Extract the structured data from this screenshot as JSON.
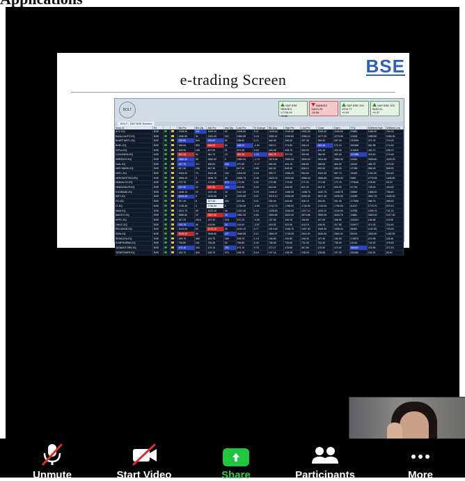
{
  "page_heading": "Applications",
  "slide": {
    "logo": "BSE",
    "title": "e-trading Screen"
  },
  "ets": {
    "logo_label": "BOLT",
    "tab": "BOLT - S&P BSE Sensex",
    "indices": [
      {
        "name": "S&P BSE SENSEX",
        "value": "17735.94",
        "change": "+5.80",
        "trend": "up"
      },
      {
        "name": "BANKEX",
        "value": "11813.25",
        "change": "-18.08",
        "trend": "dn"
      },
      {
        "name": "S&P BSE 200",
        "value": "2203.77",
        "change": "+0.93",
        "trend": "up"
      },
      {
        "name": "S&P BSE 100",
        "value": "5483.51",
        "change": "+0.37",
        "trend": "up"
      }
    ],
    "columns": [
      "Scrip Id",
      "Ex",
      "",
      "",
      "Bid Prc",
      "Bid Qty",
      "Ask Prc",
      "Ask Qty",
      "Last Prc",
      "% Change",
      "Wt. Avg",
      "High Prc",
      "Low Prc",
      "Close",
      "Open",
      "TTQ",
      "52Week High",
      "52Week Low"
    ],
    "rows": [
      {
        "sym": "ACC-EQ",
        "ex": "BSE",
        "bid": "1008.50",
        "bq": "101",
        "ask": "1009.00",
        "aq": "62",
        "last": "1008.50",
        "chg": "0.21",
        "wavg": "1009.63",
        "high": "1019.90",
        "low": "1002.05",
        "close": "1006.40",
        "open": "1005.00",
        "ttq": "29583",
        "h52": "1166.90",
        "l52": "754.00",
        "hl": {
          "bq": "b"
        }
      },
      {
        "sym": "BAJAJ-AUTO-EQ",
        "ex": "BSE",
        "bid": "2280.55",
        "bq": "31",
        "ask": "2281.00",
        "aq": "112",
        "last": "2280.55",
        "chg": "0.15",
        "wavg": "2283.42",
        "high": "2299.80",
        "low": "2266.10",
        "close": "2277.20",
        "open": "2270.00",
        "ttq": "12428",
        "h52": "2383.80",
        "l52": "1583.30",
        "hl": {}
      },
      {
        "sym": "BHARTIARTL-EQ",
        "ex": "BSE",
        "bid": "338.55",
        "bq": "840",
        "ask": "338.60",
        "aq": "52",
        "last": "338.60",
        "chg": "0.71",
        "wavg": "340.08",
        "high": "345.20",
        "low": "337.35",
        "close": "336.20",
        "open": "337.00",
        "ttq": "210059",
        "h52": "373.75",
        "l52": "274.25",
        "hl": {
          "bid": "b",
          "ask": "b"
        }
      },
      {
        "sym": "BHEL-EQ",
        "ex": "BSE",
        "bid": "268.00",
        "bq": "500",
        "ask": "268.05",
        "aq": "60",
        "last": "268.00",
        "chg": "-0.54",
        "wavg": "269.12",
        "high": "273.60",
        "low": "266.10",
        "close": "269.45",
        "open": "272.10",
        "ttq": "262456",
        "h52": "281.55",
        "l52": "174.40",
        "hl": {
          "ask": "r",
          "last": "b",
          "close": "b"
        }
      },
      {
        "sym": "CIPLA-EQ",
        "ex": "BSE",
        "bid": "406.90",
        "bq": "185",
        "ask": "407.25",
        "aq": "21",
        "last": "407.25",
        "chg": "0.53",
        "wavg": "405.49",
        "high": "408.70",
        "low": "402.00",
        "close": "405.10",
        "open": "404.00",
        "ttq": "101829",
        "h52": "452.70",
        "l52": "295.70",
        "hl": {}
      },
      {
        "sym": "COALINDIA-EQ",
        "ex": "BSE",
        "bid": "361.35",
        "bq": "54",
        "ask": "361.70",
        "aq": "13",
        "last": "361.35",
        "chg": "1.23",
        "wavg": "360.75",
        "high": "397.00",
        "low": "359.55",
        "close": "356.95",
        "open": "359.00",
        "ttq": "121388",
        "h52": "423.40",
        "l52": "270.45",
        "hl": {
          "bid": "r",
          "last": "r",
          "chg": "b",
          "wavg": "r",
          "ttq": "b"
        }
      },
      {
        "sym": "DRREDDY-EQ",
        "ex": "BSE",
        "bid": "2560.00",
        "bq": "35",
        "ask": "2562.00",
        "aq": "9",
        "last": "2560.00",
        "chg": "-1.73",
        "wavg": "2575.36",
        "high": "2595.00",
        "low": "2535.00",
        "close": "2604.95",
        "open": "2580.00",
        "ttq": "16354",
        "h52": "2828.80",
        "l52": "2025.00",
        "hl": {
          "bid": "b"
        }
      },
      {
        "sym": "GAIL-EQ",
        "ex": "BSE",
        "bid": "457.75",
        "bq": "212",
        "ask": "458.00",
        "aq": "448",
        "last": "457.85",
        "chg": "-0.17",
        "wavg": "460.63",
        "high": "464.15",
        "low": "456.60",
        "close": "458.65",
        "open": "464.00",
        "ttq": "24426",
        "h52": "489.75",
        "l52": "273.00",
        "hl": {
          "bid": "b",
          "aq": "b"
        }
      },
      {
        "sym": "HDFCBANK-EQ",
        "ex": "BSE",
        "bid": "847.30",
        "bq": "156",
        "ask": "847.35",
        "aq": "70",
        "last": "847.30",
        "chg": "0.88",
        "wavg": "842.51",
        "high": "849.00",
        "low": "836.10",
        "close": "839.90",
        "open": "838.00",
        "ttq": "47098",
        "h52": "856.00",
        "l52": "528.90",
        "hl": {}
      },
      {
        "sym": "HDFC-EQ",
        "ex": "BSE",
        "bid": "1004.00",
        "bq": "70",
        "ask": "1004.45",
        "aq": "100",
        "last": "1004.00",
        "chg": "0.15",
        "wavg": "995.77",
        "high": "1006.20",
        "low": "984.60",
        "close": "1002.45",
        "open": "987.70",
        "ttq": "15165",
        "h52": "1011.50",
        "l52": "624.40",
        "hl": {}
      },
      {
        "sym": "HEROMOTOCO-EQ",
        "ex": "BSE",
        "bid": "2595.25",
        "bq": "3",
        "ask": "2596.70",
        "aq": "26",
        "last": "2596.75",
        "chg": "0.38",
        "wavg": "2620.42",
        "high": "2623.50",
        "low": "2588.00",
        "close": "2586.85",
        "open": "2598.00",
        "ttq": "9983",
        "h52": "2775.95",
        "l52": "1636.50",
        "hl": {}
      },
      {
        "sym": "HINDALCO-EQ",
        "ex": "BSE",
        "bid": "172.70",
        "bq": "20",
        "ask": "172.80",
        "aq": "573",
        "last": "172.80",
        "chg": "0.52",
        "wavg": "172.88",
        "high": "174.50",
        "low": "171.20",
        "close": "171.90",
        "open": "172.70",
        "ttq": "273040",
        "h52": "178.50",
        "l52": "93.20",
        "hl": {
          "aq": "b"
        }
      },
      {
        "sym": "HINDUNILVR-EQ",
        "ex": "BSE",
        "bid": "622.90",
        "bq": "13",
        "ask": "622.95",
        "aq": "166",
        "last": "622.95",
        "chg": "0.04",
        "wavg": "624.54",
        "high": "628.90",
        "low": "622.20",
        "close": "622.70",
        "open": "626.00",
        "ttq": "41726",
        "h52": "725.00",
        "l52": "434.00",
        "hl": {
          "bid": "b",
          "ask": "r",
          "aq": "b"
        }
      },
      {
        "sym": "ICICIBANK-EQ",
        "ex": "BSE",
        "bid": "1446.10",
        "bq": "10",
        "ask": "1447.00",
        "aq": "18",
        "last": "1447.00",
        "chg": "0.29",
        "wavg": "1448.47",
        "high": "1455.00",
        "low": "1438.75",
        "close": "1442.75",
        "open": "1448.70",
        "ttq": "26856",
        "h52": "1386.30",
        "l52": "758.60",
        "hl": {}
      },
      {
        "sym": "INFY-EQ",
        "ex": "BSE",
        "bid": "3229.35",
        "bq": "5",
        "ask": "3229.50",
        "aq": "31",
        "last": "3229.50",
        "chg": "0.07",
        "wavg": "3219.10",
        "high": "3230.95",
        "low": "3200.00",
        "close": "3227.45",
        "open": "3205.00",
        "ttq": "13035",
        "h52": "3547.25",
        "l52": "2425.00",
        "hl": {
          "bid": "b"
        }
      },
      {
        "sym": "ITC-EQ",
        "ex": "BSE",
        "bid": "327.25",
        "bq": "8",
        "ask": "327.35",
        "aq": "200",
        "last": "327.35",
        "chg": "0.21",
        "wavg": "332.94",
        "high": "334.80",
        "low": "326.75",
        "close": "326.95",
        "open": "331.00",
        "ttq": "177880",
        "h52": "368.75",
        "l52": "265.60",
        "hl": {
          "ask": "w"
        }
      },
      {
        "sym": "LT-EQ",
        "ex": "BSE",
        "bid": "1735.40",
        "bq": "3",
        "ask": "1736.50",
        "aq": "6",
        "last": "1735.45",
        "chg": "-0.55",
        "wavg": "1742.75",
        "high": "1758.00",
        "low": "1730.00",
        "close": "1745.05",
        "open": "1755.00",
        "ttq": "40437",
        "h52": "1774.70",
        "l52": "979.10",
        "hl": {
          "ask": "w"
        }
      },
      {
        "sym": "M&M-EQ",
        "ex": "BSE",
        "bid": "1221.75",
        "bq": "25",
        "ask": "1222.40",
        "aq": "46",
        "last": "1222.40",
        "chg": "1.10",
        "wavg": "1225.90",
        "high": "1240.00",
        "low": "1217.10",
        "close": "1209.10",
        "open": "1240.00",
        "ttq": "19785",
        "h52": "1299.75",
        "l52": "741.15",
        "hl": {}
      },
      {
        "sym": "MARUTI-EQ",
        "ex": "BSE",
        "bid": "2580.50",
        "bq": "19",
        "ask": "2581.00",
        "aq": "15",
        "last": "2581.00",
        "chg": "0.84",
        "wavg": "2606.85",
        "high": "2622.00",
        "low": "2570.85",
        "close": "2559.35",
        "open": "2616.75",
        "ttq": "19861",
        "h52": "2663.00",
        "l52": "1217.00",
        "hl": {
          "ask": "r",
          "aq": "b"
        }
      },
      {
        "sym": "NTPC-EQ",
        "ex": "BSE",
        "bid": "157.25",
        "bq": "2516",
        "ask": "157.30",
        "aq": "218",
        "last": "157.25",
        "chg": "-0.25",
        "wavg": "157.94",
        "high": "159.10",
        "low": "156.60",
        "close": "157.65",
        "open": "158.95",
        "ttq": "134261",
        "h52": "166.68",
        "l52": "119.90",
        "hl": {}
      },
      {
        "sym": "ONGC-EQ",
        "ex": "BSE",
        "bid": "415.75",
        "bq": "65",
        "ask": "415.90",
        "aq": "16",
        "last": "415.90",
        "chg": "-0.57",
        "wavg": "419.52",
        "high": "423.50",
        "low": "415.15",
        "close": "418.30",
        "open": "417.80",
        "ttq": "229977",
        "h52": "472.00",
        "l52": "234.40",
        "hl": {
          "bid": "b",
          "aq": "b"
        }
      },
      {
        "sym": "RELIANCE-EQ",
        "ex": "BSE",
        "bid": "1014.00",
        "bq": "60",
        "ask": "1014.10",
        "aq": "20",
        "last": "1014.10",
        "chg": "0.77",
        "wavg": "1013.45",
        "high": "1018.75",
        "low": "1007.00",
        "close": "1006.35",
        "open": "1008.00",
        "ttq": "95084",
        "h52": "1142.55",
        "l52": "793.00",
        "hl": {
          "ask": "r"
        }
      },
      {
        "sym": "SBIN-EQ",
        "ex": "BSE",
        "bid": "2648.00",
        "bq": "96",
        "ask": "2648.60",
        "aq": "107",
        "last": "2648.55",
        "chg": "0.11",
        "wavg": "2660.97",
        "high": "2718.95",
        "low": "2644.00",
        "close": "2645.65",
        "open": "2690.00",
        "ttq": "55194",
        "h52": "2833.80",
        "l52": "1452.00",
        "hl": {
          "bid": "r",
          "aq": "b"
        }
      },
      {
        "sym": "SESAGOA-EQ",
        "ex": "BSE",
        "bid": "199.70",
        "bq": "484",
        "ask": "199.75",
        "aq": "286",
        "last": "199.75",
        "chg": "1.19",
        "wavg": "198.89",
        "high": "200.80",
        "low": "196.00",
        "close": "197.40",
        "open": "196.00",
        "ttq": "176570",
        "h52": "219.95",
        "l52": "118.40",
        "hl": {}
      },
      {
        "sym": "SUNPHARMA-EQ",
        "ex": "BSE",
        "bid": "736.80",
        "bq": "161",
        "ask": "736.95",
        "aq": "52",
        "last": "736.85",
        "chg": "0.34",
        "wavg": "735.94",
        "high": "739.50",
        "low": "731.05",
        "close": "734.35",
        "open": "735.00",
        "ttq": "21616",
        "h52": "744.30",
        "l52": "475.30",
        "hl": {}
      },
      {
        "sym": "TATAMOTORS-EQ",
        "ex": "BSE",
        "bid": "474.10",
        "bq": "400",
        "ask": "474.15",
        "aq": "250",
        "last": "474.15",
        "chg": "0.78",
        "wavg": "472.17",
        "high": "475.80",
        "low": "467.80",
        "close": "470.50",
        "open": "470.00",
        "ttq": "264461",
        "h52": "476.55",
        "l52": "272.15",
        "hl": {
          "bid": "b",
          "aq": "b",
          "ttq": "b"
        }
      },
      {
        "sym": "TATAPOWER-EQ",
        "ex": "BSE",
        "bid": "106.70",
        "bq": "300",
        "ask": "106.75",
        "aq": "370",
        "last": "106.75",
        "chg": "0.14",
        "wavg": "107.14",
        "high": "108.25",
        "low": "106.35",
        "close": "106.60",
        "open": "107.30",
        "ttq": "261080",
        "h52": "115.25",
        "l52": "83.40",
        "hl": {}
      }
    ]
  },
  "toolbar": {
    "unmute": "Unmute",
    "start_video": "Start Video",
    "share": "Share",
    "participants": "Participants",
    "more": "More"
  },
  "colors": {
    "share_green": "#1fc63e",
    "mute_red": "#d9302c",
    "bse_blue": "#2a62b8"
  }
}
